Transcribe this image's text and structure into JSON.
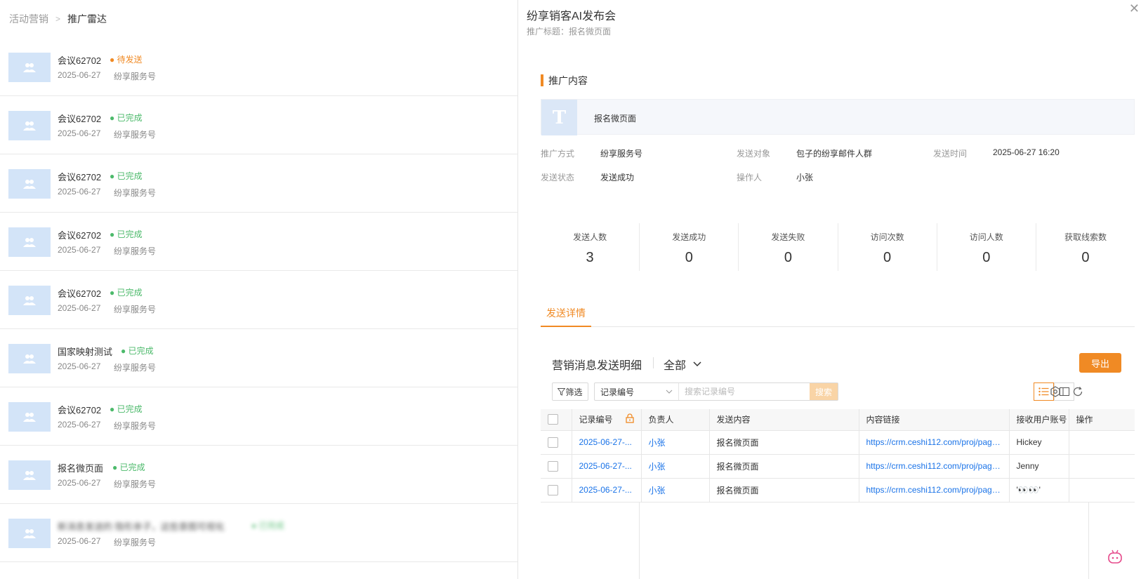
{
  "breadcrumb": {
    "parent": "活动营销",
    "current": "推广雷达"
  },
  "list": {
    "items": [
      {
        "title": "会议62702",
        "status": "待发送",
        "status_type": "pending",
        "date": "2025-06-27",
        "channel": "纷享服务号"
      },
      {
        "title": "会议62702",
        "status": "已完成",
        "status_type": "done",
        "date": "2025-06-27",
        "channel": "纷享服务号"
      },
      {
        "title": "会议62702",
        "status": "已完成",
        "status_type": "done",
        "date": "2025-06-27",
        "channel": "纷享服务号"
      },
      {
        "title": "会议62702",
        "status": "已完成",
        "status_type": "done",
        "date": "2025-06-27",
        "channel": "纷享服务号"
      },
      {
        "title": "会议62702",
        "status": "已完成",
        "status_type": "done",
        "date": "2025-06-27",
        "channel": "纷享服务号"
      },
      {
        "title": "国家映射测试",
        "status": "已完成",
        "status_type": "done",
        "date": "2025-06-27",
        "channel": "纷享服务号"
      },
      {
        "title": "会议62702",
        "status": "已完成",
        "status_type": "done",
        "date": "2025-06-27",
        "channel": "纷享服务号"
      },
      {
        "title": "报名微页面",
        "status": "已完成",
        "status_type": "done",
        "date": "2025-06-27",
        "channel": "纷享服务号"
      },
      {
        "title": "新消息发送的 隐形亲子，这些意图可视化",
        "status": "已完成",
        "status_type": "done",
        "date": "2025-06-27",
        "channel": "纷享服务号"
      }
    ]
  },
  "panel": {
    "title": "纷享销客AI发布会",
    "subtitle": "推广标题：报名微页面",
    "section_title": "推广内容",
    "content_card": {
      "icon_letter": "T",
      "name": "报名微页面"
    },
    "info": [
      {
        "label": "推广方式",
        "value": "纷享服务号"
      },
      {
        "label": "发送对象",
        "value": "包子的纷享邮件人群"
      },
      {
        "label": "发送时间",
        "value": "2025-06-27 16:20"
      },
      {
        "label": "发送状态",
        "value": "发送成功"
      },
      {
        "label": "操作人",
        "value": "小张"
      }
    ],
    "stats": [
      {
        "label": "发送人数",
        "value": "3"
      },
      {
        "label": "发送成功",
        "value": "0"
      },
      {
        "label": "发送失败",
        "value": "0"
      },
      {
        "label": "访问次数",
        "value": "0"
      },
      {
        "label": "访问人数",
        "value": "0"
      },
      {
        "label": "获取线索数",
        "value": "0"
      }
    ],
    "tab_label": "发送详情",
    "table": {
      "title": "营销消息发送明细",
      "scope": "全部",
      "export_label": "导出",
      "filter_label": "筛选",
      "search_field": "记录编号",
      "search_placeholder": "搜索记录编号",
      "search_btn": "搜索",
      "columns": [
        "记录编号",
        "负责人",
        "发送内容",
        "内容链接",
        "接收用户账号",
        "操作"
      ],
      "rows": [
        {
          "id": "2025-06-27-...",
          "owner": "小张",
          "content": "报名微页面",
          "link": "https://crm.ceshi112.com/proj/page/...",
          "account": "Hickey"
        },
        {
          "id": "2025-06-27-...",
          "owner": "小张",
          "content": "报名微页面",
          "link": "https://crm.ceshi112.com/proj/page/...",
          "account": "Jenny"
        },
        {
          "id": "2025-06-27-...",
          "owner": "小张",
          "content": "报名微页面",
          "link": "https://crm.ceshi112.com/proj/page/...",
          "account": "'👀👀'"
        }
      ]
    }
  },
  "colors": {
    "accent": "#f08a24",
    "done": "#4cba6b",
    "link": "#1a73e8"
  }
}
